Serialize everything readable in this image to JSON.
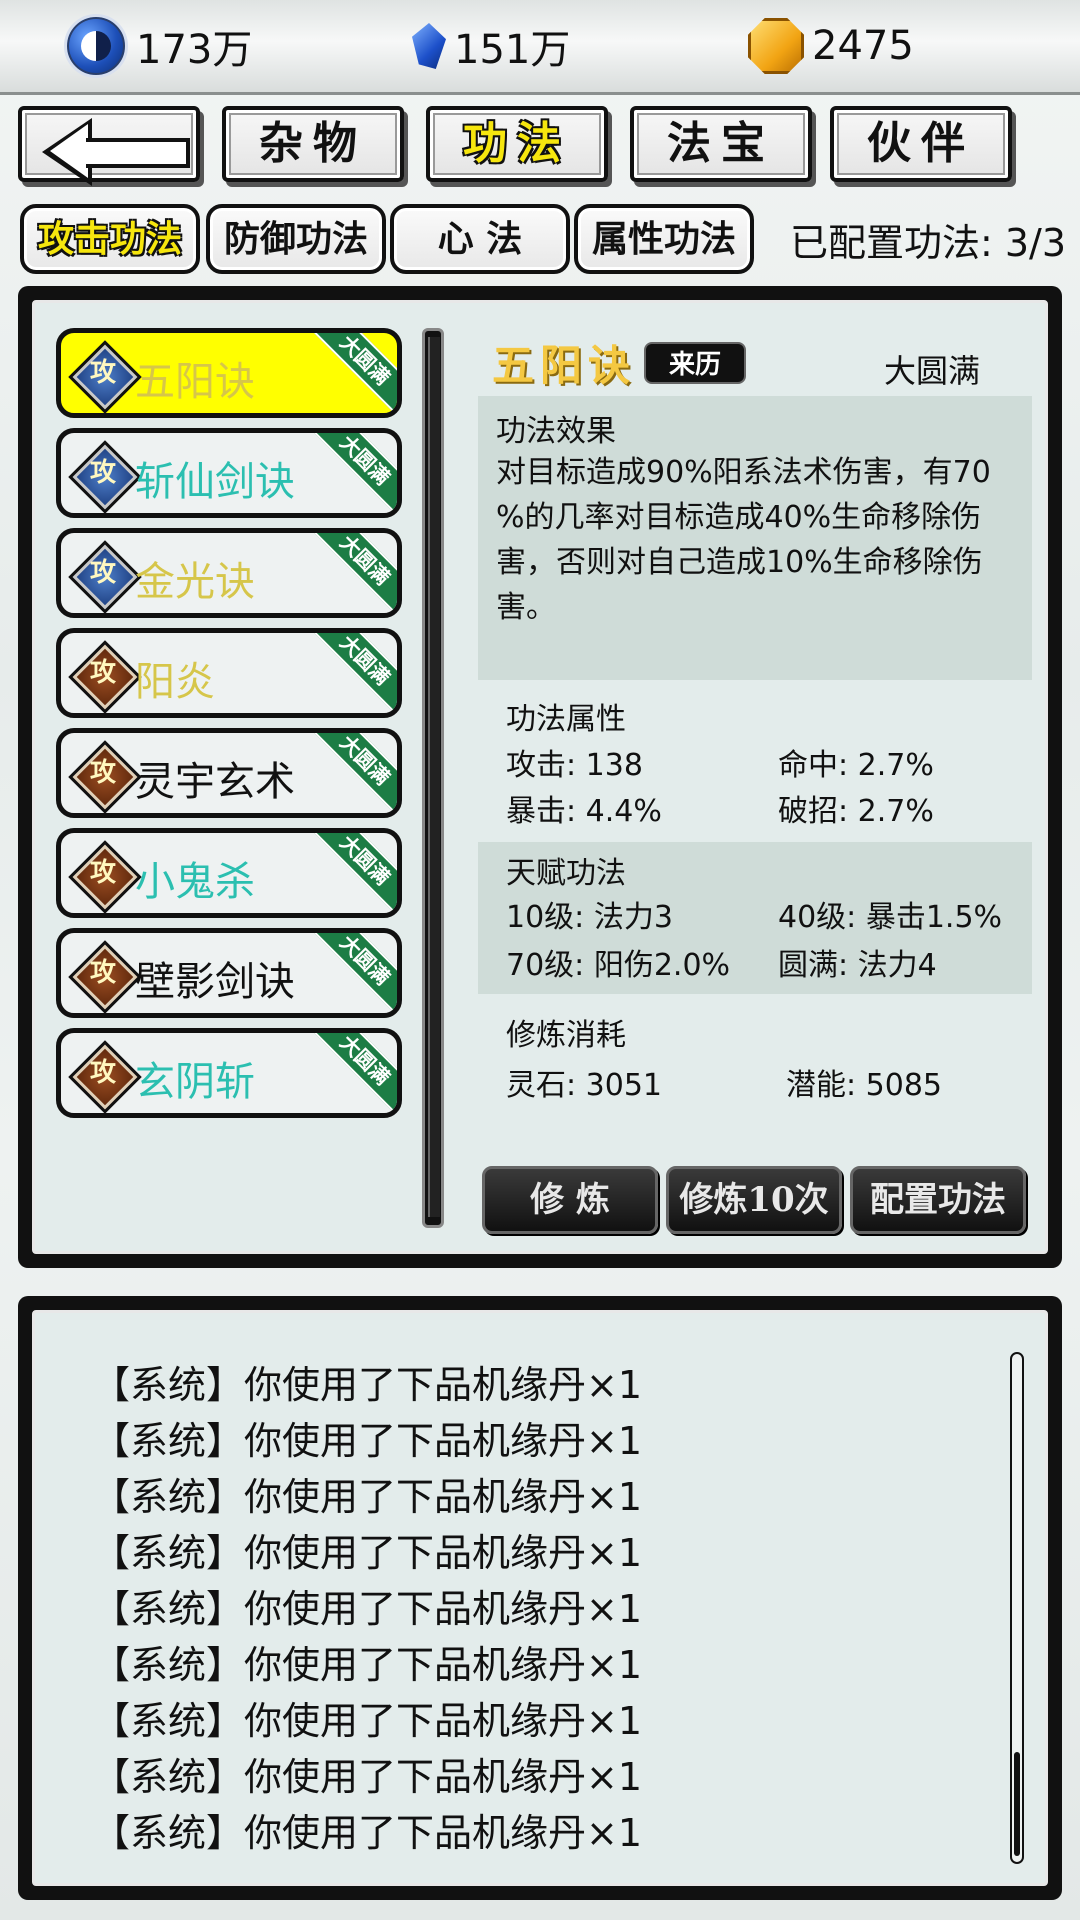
{
  "resources": {
    "spirit": "173万",
    "crystal": "151万",
    "gold": "2475"
  },
  "main_tabs": [
    "杂物",
    "功法",
    "法宝",
    "伙伴"
  ],
  "sub_tabs": [
    "攻击功法",
    "防御功法",
    "心 法",
    "属性功法"
  ],
  "configured_label": "已配置功法: 3/3",
  "skill_list": [
    {
      "name": "五阳诀",
      "badge": "大圆满",
      "icon": "attack-icon"
    },
    {
      "name": "斩仙剑诀",
      "badge": "大圆满",
      "icon": "attack-icon"
    },
    {
      "name": "金光诀",
      "badge": "大圆满",
      "icon": "attack-icon"
    },
    {
      "name": "阳炎",
      "badge": "大圆满",
      "icon": "attack-icon"
    },
    {
      "name": "灵宇玄术",
      "badge": "大圆满",
      "icon": "attack-icon"
    },
    {
      "name": "小鬼杀",
      "badge": "大圆满",
      "icon": "attack-icon"
    },
    {
      "name": "壁影剑诀",
      "badge": "大圆满",
      "icon": "attack-icon"
    },
    {
      "name": "玄阴斩",
      "badge": "大圆满",
      "icon": "attack-icon"
    }
  ],
  "icon_glyph": "攻",
  "detail": {
    "title": "五阳诀",
    "origin_button": "来历",
    "level": "大圆满",
    "effect_heading": "功法效果",
    "effect_lines": [
      "对目标造成90%阳系法术伤害，有70",
      "%的几率对目标造成40%生命移除伤",
      "害，否则对自己造成10%生命移除伤",
      "害。"
    ],
    "attr_heading": "功法属性",
    "attrs": [
      "攻击: 138",
      "命中: 2.7%",
      "暴击: 4.4%",
      "破招: 2.7%"
    ],
    "talent_heading": "天赋功法",
    "talents": [
      "10级: 法力3",
      "40级: 暴击1.5%",
      "70级: 阳伤2.0%",
      "圆满: 法力4"
    ],
    "cost_heading": "修炼消耗",
    "costs": [
      "灵石: 3051",
      "潜能: 5085"
    ]
  },
  "actions": [
    "修 炼",
    "修炼10次",
    "配置功法"
  ],
  "log_lines": [
    "【系统】你使用了下品机缘丹×1",
    "【系统】你使用了下品机缘丹×1",
    "【系统】你使用了下品机缘丹×1",
    "【系统】你使用了下品机缘丹×1",
    "【系统】你使用了下品机缘丹×1",
    "【系统】你使用了下品机缘丹×1",
    "【系统】你使用了下品机缘丹×1",
    "【系统】你使用了下品机缘丹×1",
    "【系统】你使用了下品机缘丹×1"
  ],
  "colors": {
    "selected_bg": "#ffff00",
    "active_tab_text": "#f6e60e",
    "name_cyan": "#2bbfb0",
    "name_yellow": "#d6c64a",
    "name_black": "#111111",
    "title_gold": "#f4c842"
  }
}
